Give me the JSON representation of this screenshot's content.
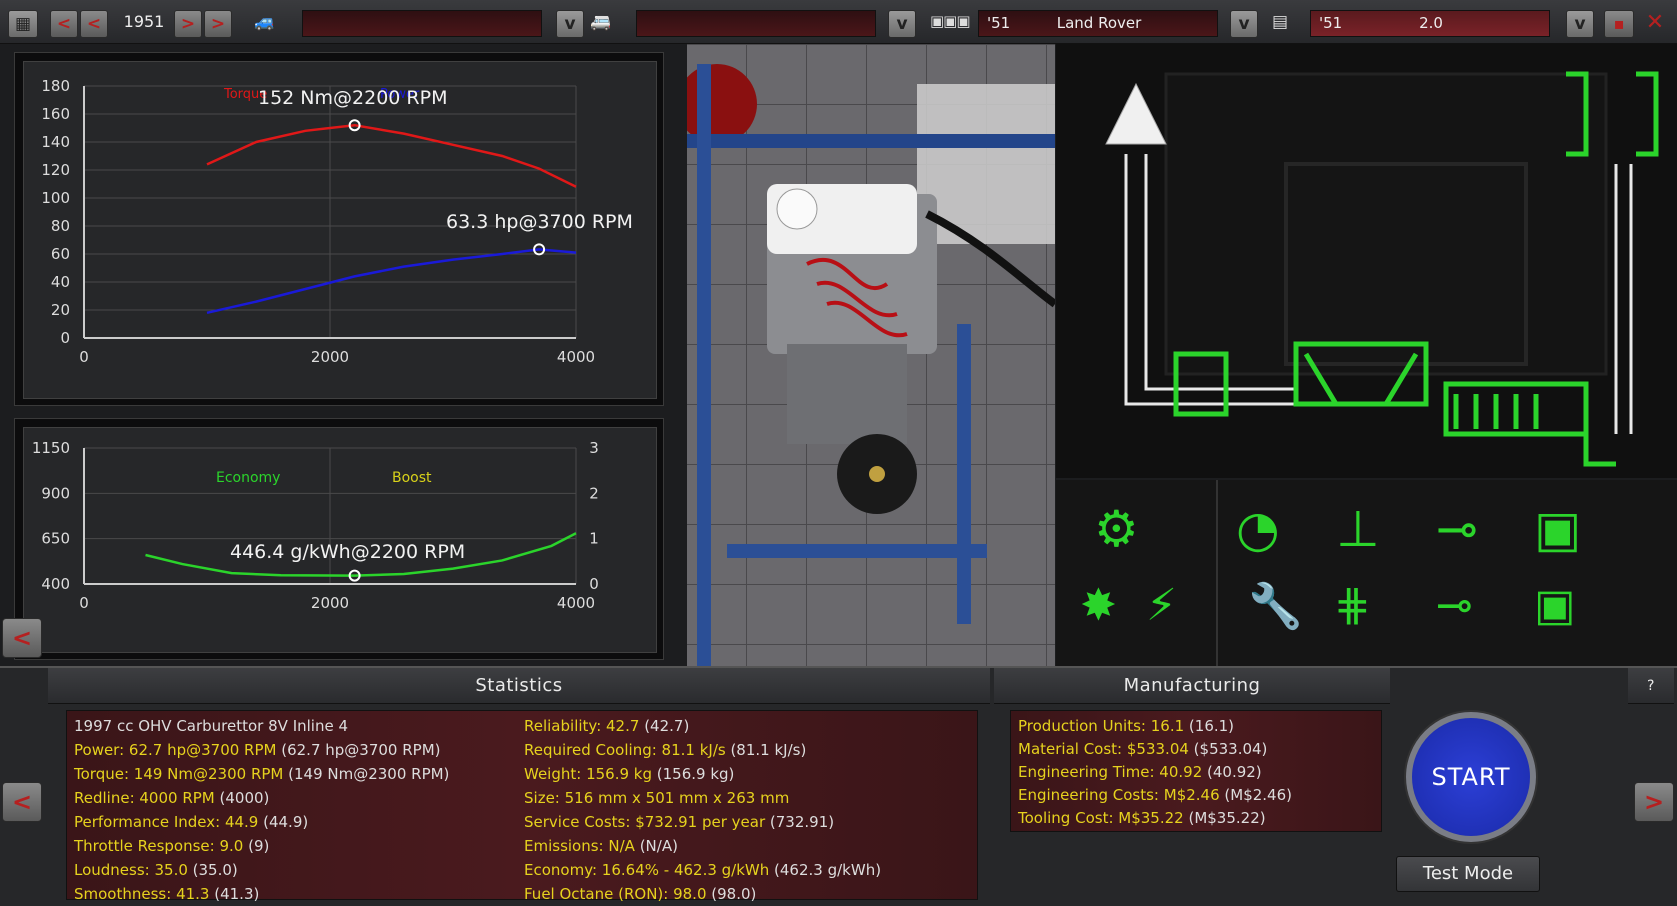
{
  "toolbar": {
    "year": "1951",
    "car_model_value": "",
    "trim_value": "",
    "engine_year": "'51",
    "engine_name": "Land Rover",
    "variant_year": "'51",
    "variant_name": "2.0",
    "prev_label": "<",
    "next_label": ">",
    "dropdown_label": "v"
  },
  "torque_chart": {
    "ylim": [
      0,
      180
    ],
    "xlim": [
      0,
      4000
    ],
    "y_ticks": [
      "180",
      "160",
      "140",
      "120",
      "100",
      "80",
      "60",
      "40",
      "20",
      "0"
    ],
    "x_ticks": [
      "0",
      "2000",
      "4000"
    ],
    "legend_torque": "Torque",
    "legend_power": "Power",
    "torque_annotation": "152 Nm@2200 RPM",
    "power_annotation": "63.3 hp@3700 RPM",
    "colors": {
      "torque": "#e01818",
      "power": "#1a1ad8"
    }
  },
  "economy_chart": {
    "y_ticks": [
      "1150",
      "900",
      "650",
      "400"
    ],
    "y2_ticks": [
      "3",
      "2",
      "1",
      "0"
    ],
    "x_ticks": [
      "0",
      "2000",
      "4000"
    ],
    "legend_economy": "Economy",
    "legend_boost": "Boost",
    "annotation": "446.4 g/kWh@2200 RPM",
    "colors": {
      "economy": "#2bd42b",
      "boost": "#d8d21a"
    }
  },
  "chart_data": [
    {
      "type": "line",
      "xlim": [
        0,
        4000
      ],
      "ylim": [
        0,
        180
      ],
      "series": [
        {
          "name": "Torque",
          "x": [
            1000,
            1400,
            1800,
            2200,
            2600,
            3000,
            3400,
            3700,
            4000
          ],
          "values": [
            124,
            140,
            148,
            152,
            146,
            138,
            130,
            121,
            108
          ]
        },
        {
          "name": "Power",
          "x": [
            1000,
            1400,
            1800,
            2200,
            2600,
            3000,
            3400,
            3700,
            4000
          ],
          "values": [
            18,
            26,
            35,
            44,
            51,
            56,
            60,
            63.3,
            61
          ]
        }
      ]
    },
    {
      "type": "line",
      "xlim": [
        0,
        4000
      ],
      "ylim": [
        400,
        1150
      ],
      "y2lim": [
        0,
        3
      ],
      "series": [
        {
          "name": "Economy",
          "x": [
            500,
            800,
            1200,
            1600,
            2000,
            2200,
            2600,
            3000,
            3400,
            3800,
            4000
          ],
          "values": [
            560,
            510,
            460,
            448,
            447,
            446.4,
            455,
            485,
            530,
            610,
            680
          ]
        }
      ]
    }
  ],
  "bottom": {
    "statistics_title": "Statistics",
    "manufacturing_title": "Manufacturing",
    "help_label": "?",
    "stats_left": [
      {
        "label": "1997 cc OHV Carburettor 8V Inline 4",
        "value": ""
      },
      {
        "label": "Power: 62.7 hp@3700 RPM",
        "value": " (62.7 hp@3700 RPM)"
      },
      {
        "label": "Torque: 149 Nm@2300 RPM",
        "value": " (149 Nm@2300 RPM)"
      },
      {
        "label": "Redline: 4000 RPM",
        "value": " (4000)"
      },
      {
        "label": "Performance Index: 44.9",
        "value": " (44.9)"
      },
      {
        "label": "Throttle Response: 9.0",
        "value": " (9)"
      },
      {
        "label": "Loudness: 35.0",
        "value": " (35.0)"
      },
      {
        "label": "Smoothness: 41.3",
        "value": " (41.3)"
      }
    ],
    "stats_right": [
      {
        "label": "Reliability: 42.7",
        "value": " (42.7)"
      },
      {
        "label": "Required Cooling: 81.1 kJ/s",
        "value": " (81.1 kJ/s)"
      },
      {
        "label": "Weight: 156.9 kg",
        "value": " (156.9 kg)"
      },
      {
        "label": "Size: 516 mm x 501 mm x 263 mm",
        "value": ""
      },
      {
        "label": "Service Costs: $732.91 per year",
        "value": " (732.91)"
      },
      {
        "label": "Emissions: N/A",
        "value": " (N/A)"
      },
      {
        "label": "Economy: 16.64% - 462.3 g/kWh",
        "value": " (462.3 g/kWh)"
      },
      {
        "label": "Fuel Octane (RON): 98.0",
        "value": " (98.0)"
      }
    ],
    "manufacturing": [
      {
        "label": "Production Units: 16.1",
        "value": " (16.1)"
      },
      {
        "label": "Material Cost: $533.04",
        "value": " ($533.04)"
      },
      {
        "label": "Engineering Time: 40.92",
        "value": " (40.92)"
      },
      {
        "label": "Engineering Costs: M$2.46",
        "value": " (M$2.46)"
      },
      {
        "label": "Tooling Cost: M$35.22",
        "value": " (M$35.22)"
      }
    ],
    "start_label": "START",
    "test_mode_label": "Test Mode",
    "left_arrow": "<",
    "right_arrow": ">"
  }
}
